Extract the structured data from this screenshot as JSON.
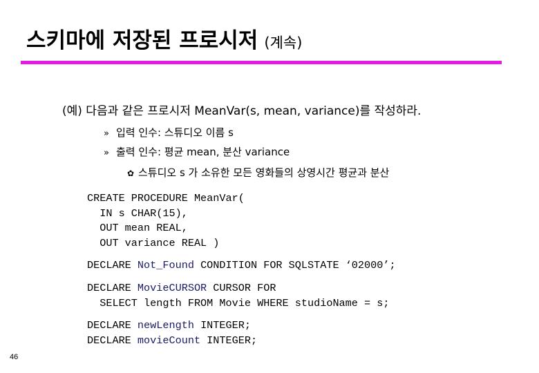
{
  "slide": {
    "title": "스키마에 저장된 프로시저",
    "title_suffix": "(계속)",
    "accent_color": "#e619e6",
    "example": "(예) 다음과 같은 프로시저 MeanVar(s, mean, variance)를 작성하라.",
    "bullets": [
      {
        "marker": "»",
        "text": "입력 인수: 스튜디오 이름 s"
      },
      {
        "marker": "»",
        "text": "출력 인수: 평균 mean, 분산 variance"
      }
    ],
    "sub_bullet": {
      "marker": "✿",
      "text": "스튜디오 s 가 소유한 모든 영화들의 상영시간 평균과 분산"
    },
    "code": {
      "identifier_color": "#1a1a66",
      "block1": [
        "CREATE PROCEDURE MeanVar(",
        "  IN s CHAR(15),",
        "  OUT mean REAL,",
        "  OUT variance REAL )"
      ],
      "block2": {
        "kw1": "DECLARE ",
        "ident": "Not_Found",
        "rest": " CONDITION FOR SQLSTATE ‘02000’;"
      },
      "block3": {
        "kw1": "DECLARE ",
        "ident": "MovieCURSOR",
        "rest": " CURSOR FOR",
        "line2": "  SELECT length FROM Movie WHERE studioName = s;"
      },
      "block4": [
        {
          "kw1": "DECLARE ",
          "ident": "newLength",
          "rest": " INTEGER;"
        },
        {
          "kw1": "DECLARE ",
          "ident": "movieCount",
          "rest": " INTEGER;"
        }
      ]
    },
    "page_number": "46"
  }
}
